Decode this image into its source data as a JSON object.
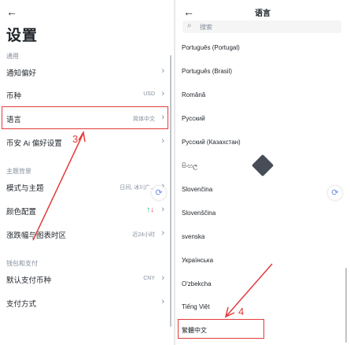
{
  "left": {
    "title": "设置",
    "sections": [
      "通用",
      "主题背景",
      "钱包和支付"
    ],
    "rows": [
      {
        "label": "通知偏好",
        "value": ""
      },
      {
        "label": "币种",
        "value": "USD"
      },
      {
        "label": "语言",
        "value": "简体中文"
      },
      {
        "label": "币安 Ai 偏好设置",
        "value": ""
      },
      {
        "label": "模式与主题",
        "value": "日间, 冰川广..."
      },
      {
        "label": "颜色配置",
        "value": ""
      },
      {
        "label": "涨跌幅与图表时区",
        "value": "近24小时"
      },
      {
        "label": "默认支付币种",
        "value": "CNY"
      },
      {
        "label": "支付方式",
        "value": ""
      }
    ],
    "color_config_arrows": {
      "up": "↑",
      "down": "↓"
    },
    "annotation_number": "3"
  },
  "right": {
    "title": "语言",
    "search_placeholder": "搜索",
    "languages": [
      "Português (Portugal)",
      "Português (Brasil)",
      "Română",
      "Русский",
      "Русский (Казахстан)",
      "සිංහල",
      "Slovenčina",
      "Slovenščina",
      "svenska",
      "Українська",
      "O'zbekcha",
      "Tiếng Việt",
      "繁體中文"
    ],
    "annotation_number": "4"
  },
  "icons": {
    "back": "back-arrow-icon",
    "chevron": "chevron-right-icon",
    "search": "search-icon",
    "float": "refresh-icon"
  },
  "colors": {
    "annotation": "#e33b3b",
    "up": "#0ecb81",
    "down": "#f6465d"
  }
}
